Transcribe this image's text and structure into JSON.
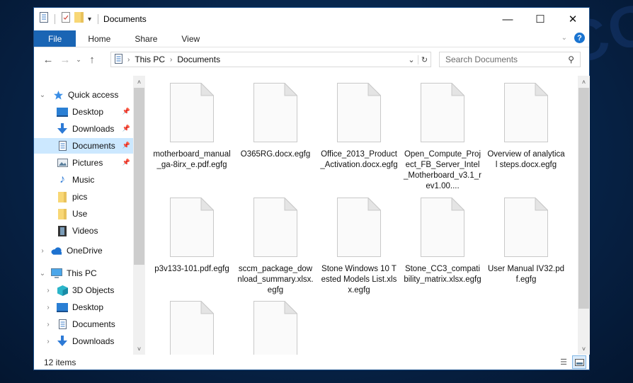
{
  "window": {
    "title": "Documents",
    "controls": {
      "minimize": "—",
      "maximize": "☐",
      "close": "✕"
    }
  },
  "ribbon": {
    "tabs": [
      {
        "label": "File",
        "active": true
      },
      {
        "label": "Home"
      },
      {
        "label": "Share"
      },
      {
        "label": "View"
      }
    ],
    "help_label": "?"
  },
  "address": {
    "breadcrumb": [
      "This PC",
      "Documents"
    ],
    "search_placeholder": "Search Documents"
  },
  "navpane": {
    "items": [
      {
        "label": "Quick access",
        "icon": "star-icon",
        "level": 0,
        "chevron": "expanded"
      },
      {
        "label": "Desktop",
        "icon": "desktop-icon",
        "level": 1,
        "pinned": true
      },
      {
        "label": "Downloads",
        "icon": "download-icon",
        "level": 1,
        "pinned": true
      },
      {
        "label": "Documents",
        "icon": "document-icon",
        "level": 1,
        "pinned": true,
        "selected": true
      },
      {
        "label": "Pictures",
        "icon": "pictures-icon",
        "level": 1,
        "pinned": true
      },
      {
        "label": "Music",
        "icon": "music-icon",
        "level": 1
      },
      {
        "label": "pics",
        "icon": "folder-icon",
        "level": 1
      },
      {
        "label": "Use",
        "icon": "folder-icon",
        "level": 1
      },
      {
        "label": "Videos",
        "icon": "videos-icon",
        "level": 1
      },
      {
        "label": "OneDrive",
        "icon": "cloud-icon",
        "level": 0,
        "chevron": "collapsed"
      },
      {
        "label": "This PC",
        "icon": "computer-icon",
        "level": 0,
        "chevron": "expanded"
      },
      {
        "label": "3D Objects",
        "icon": "cube-icon",
        "level": 1,
        "chevron": "collapsed"
      },
      {
        "label": "Desktop",
        "icon": "desktop-icon",
        "level": 1,
        "chevron": "collapsed"
      },
      {
        "label": "Documents",
        "icon": "document-icon",
        "level": 1,
        "chevron": "collapsed"
      },
      {
        "label": "Downloads",
        "icon": "download-icon",
        "level": 1,
        "chevron": "collapsed"
      }
    ]
  },
  "files": [
    {
      "name": "motherboard_manual_ga-8irx_e.pdf.egfg"
    },
    {
      "name": "O365RG.docx.egfg"
    },
    {
      "name": "Office_2013_Product_Activation.docx.egfg"
    },
    {
      "name": "Open_Compute_Project_FB_Server_Intel_Motherboard_v3.1_rev1.00...."
    },
    {
      "name": "Overview of analytical steps.docx.egfg"
    },
    {
      "name": "p3v133-101.pdf.egfg"
    },
    {
      "name": "sccm_package_download_summary.xlsx.egfg"
    },
    {
      "name": "Stone Windows 10 Tested Models List.xlsx.egfg"
    },
    {
      "name": "Stone_CC3_compatibility_matrix.xlsx.egfg"
    },
    {
      "name": "User Manual IV32.pdf.egfg"
    },
    {
      "name": ""
    },
    {
      "name": ""
    }
  ],
  "status": {
    "item_count": "12 items"
  },
  "watermark": "MYANTISPYWARE.COM",
  "colors": {
    "file_tab": "#1a65b4",
    "selection": "#cce8ff",
    "desktop_bg": "#072449"
  }
}
